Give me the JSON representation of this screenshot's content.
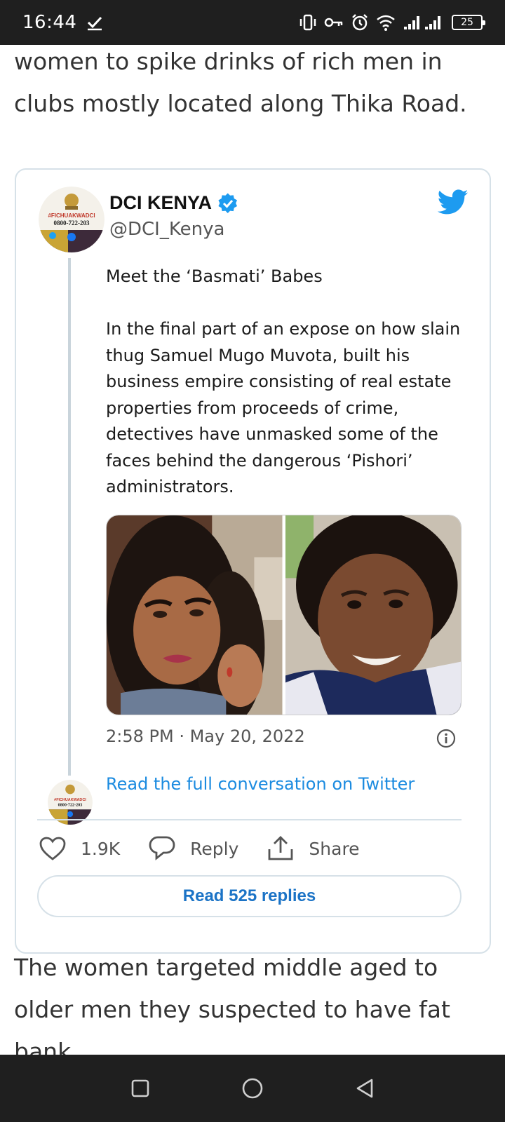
{
  "status_bar": {
    "time": "16:44",
    "battery": "25"
  },
  "article": {
    "text_top": "women to spike drinks of rich men in clubs mostly located along Thika Road.",
    "text_bottom": "The women targeted middle aged to older men they suspected to have fat bank"
  },
  "tweet": {
    "author_name": "DCI KENYA",
    "handle": "@DCI_Kenya",
    "avatar_text": "#FICHUAKWADCI",
    "avatar_number": "0800-722-203",
    "paragraphs": [
      "Meet the ‘Basmati’ Babes",
      "In the final part of an expose on how slain thug Samuel Mugo Muvota, built his business empire consisting of real estate properties from proceeds of crime, detectives have unmasked some of the faces behind the dangerous ‘Pishori’ administrators."
    ],
    "timestamp": "2:58 PM · May 20, 2022",
    "read_full": "Read the full conversation on Twitter",
    "likes": "1.9K",
    "reply_label": "Reply",
    "share_label": "Share",
    "read_replies": "Read 525 replies"
  },
  "colors": {
    "twitter_blue": "#1d9bf0",
    "link_blue": "#1b8be0",
    "status_bar_bg": "#1f1f1f"
  },
  "icons": [
    "check-icon",
    "vibrate-icon",
    "key-icon",
    "alarm-icon",
    "wifi-icon",
    "signal-icon",
    "verified-icon",
    "twitter-bird-icon",
    "info-icon",
    "heart-icon",
    "reply-bubble-icon",
    "share-icon",
    "recents-icon",
    "home-icon",
    "back-icon"
  ]
}
